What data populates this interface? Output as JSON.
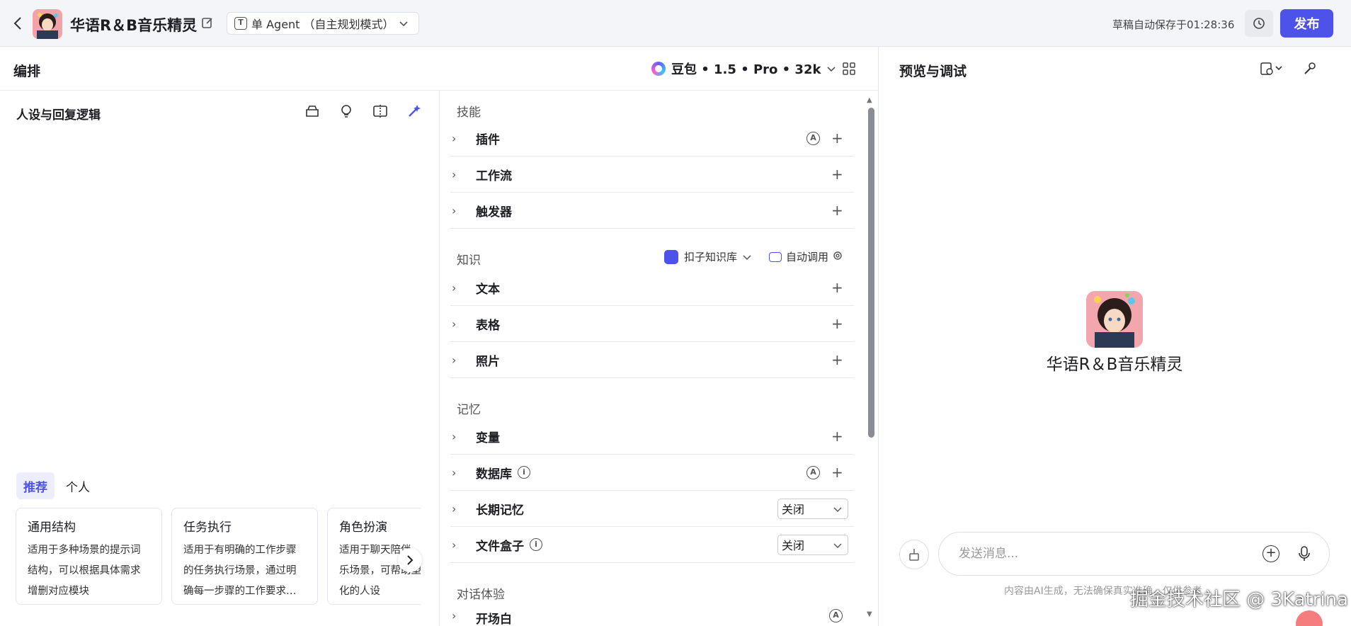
{
  "topbar": {
    "app_title": "华语R＆B音乐精灵",
    "agent_mode": "单 Agent （自主规划模式）",
    "saved_status": "草稿自动保存于01:28:36",
    "publish_label": "发布"
  },
  "editor": {
    "section_title": "编排",
    "model": "豆包 • 1.5 • Pro • 32k"
  },
  "persona": {
    "title": "人设与回复逻辑",
    "tabs": [
      "推荐",
      "个人"
    ],
    "cards": [
      {
        "title": "通用结构",
        "desc": "适用于多种场景的提示词结构，可以根据具体需求增删对应模块"
      },
      {
        "title": "任务执行",
        "desc": "适用于有明确的工作步骤的任务执行场景，通过明确每一步骤的工作要求…"
      },
      {
        "title": "角色扮演",
        "desc": "适用于聊天陪伴、互动娱乐场景，可帮助塑造个性化的人设"
      }
    ]
  },
  "skills": {
    "group_label": "技能",
    "items": [
      "插件",
      "工作流",
      "触发器"
    ]
  },
  "knowledge": {
    "group_label": "知识",
    "kb_source": "扣子知识库",
    "auto_call": "自动调用",
    "items": [
      "文本",
      "表格",
      "照片"
    ]
  },
  "memory": {
    "group_label": "记忆",
    "items": [
      "变量",
      "数据库",
      "长期记忆",
      "文件盒子"
    ],
    "long_term_value": "关闭",
    "file_box_value": "关闭"
  },
  "dialog": {
    "group_label": "对话体验",
    "items": [
      "开场白"
    ]
  },
  "preview": {
    "title": "预览与调试",
    "bot_name": "华语R＆B音乐精灵",
    "input_placeholder": "发送消息...",
    "disclaimer": "内容由AI生成，无法确保真实准确，仅供参考",
    "watermark": "掘金技术社区 @ 3Katrina"
  },
  "colors": {
    "accent": "#4d53e8",
    "topbar_bg": "#f4f5f9",
    "border": "#e6e8ec"
  }
}
